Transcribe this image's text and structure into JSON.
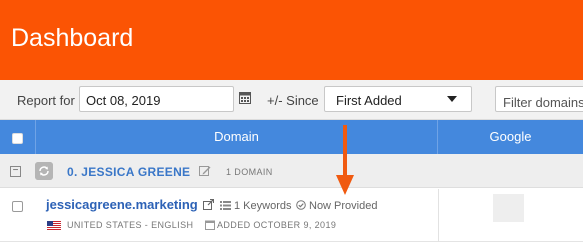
{
  "header": {
    "title": "Dashboard"
  },
  "toolbar": {
    "report_for_label": "Report for",
    "date_value": "Oct 08, 2019",
    "since_label": "+/- Since",
    "since_selected": "First Added",
    "filter_placeholder": "Filter domains"
  },
  "table": {
    "columns": [
      "Domain",
      "Google"
    ],
    "group": {
      "name": "0. JESSICA GREENE",
      "count": "1 DOMAIN"
    },
    "rows": [
      {
        "domain": "jessicagreene.marketing",
        "keywords": "1 Keywords",
        "status": "Now Provided",
        "locale": "UNITED STATES - ENGLISH",
        "added": "ADDED OCTOBER 9, 2019"
      }
    ]
  },
  "colors": {
    "brand": "#fb5404",
    "table_header": "#4488dd",
    "link": "#2d62b6",
    "annotation_arrow": "#f05a10"
  },
  "icons": [
    "calendar-icon",
    "caret-down-icon",
    "collapse-icon",
    "refresh-icon",
    "edit-icon",
    "external-link-icon",
    "list-icon",
    "check-circle-icon",
    "us-flag-icon",
    "arrow-down-icon"
  ]
}
